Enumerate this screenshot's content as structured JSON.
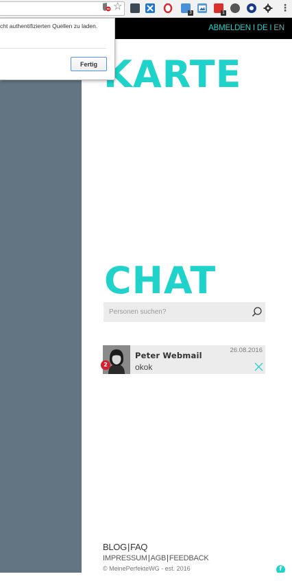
{
  "browser": {
    "popup": {
      "message": "cht authentifizierten Quellen zu laden.",
      "button_label": "Fertig"
    },
    "extension_badges": [
      "3",
      "1"
    ],
    "icons": [
      "shield-blocked-icon",
      "star-icon",
      "extension-icons",
      "settings-gear-icon",
      "menu-dots-icon"
    ]
  },
  "nav": {
    "logout": "ABMELDEN",
    "lang_de": "DE",
    "lang_en": "EN",
    "separator": "I"
  },
  "sections": {
    "map_heading": "KARTE",
    "chat_heading": "CHAT"
  },
  "search": {
    "placeholder": "Personen suchen?"
  },
  "chats": [
    {
      "name": "Peter Webmail",
      "message": "okok",
      "date": "26.08.2016",
      "unread": "2"
    }
  ],
  "footer": {
    "blog": "BLOG",
    "faq": "FAQ",
    "impressum": "IMPRESSUM",
    "agb": "AGB",
    "feedback": "FEEDBACK",
    "separator": "|",
    "copyright": "© MeinePerfekteWG - est. 2016",
    "facebook_glyph": "f"
  },
  "colors": {
    "accent": "#1fd3cb",
    "nav_bg": "#000000",
    "rail": "#637582",
    "card_bg": "#ececec",
    "badge": "#d4212b"
  }
}
